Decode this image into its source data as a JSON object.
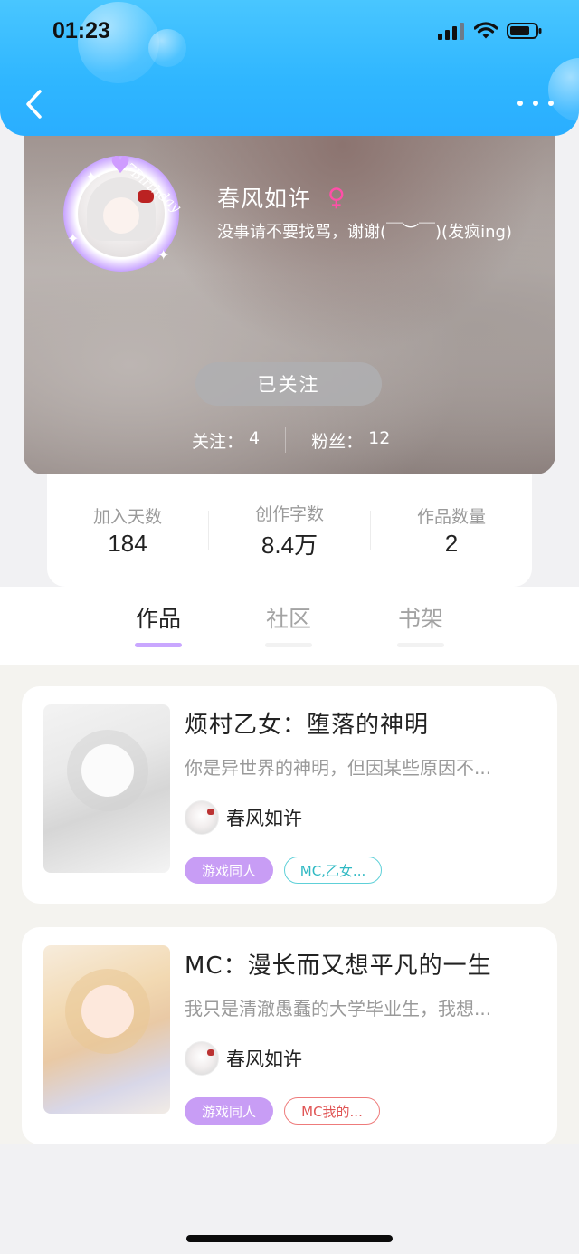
{
  "status_bar": {
    "time": "01:23"
  },
  "profile": {
    "avatar_badge": "7Birthday",
    "nickname": "春风如许",
    "gender_symbol": "♀",
    "bio": "没事请不要找骂，谢谢(￣︶￣)(发疯ing)",
    "follow_button": "已关注",
    "following_label": "关注：",
    "following_count": "4",
    "fans_label": "粉丝：",
    "fans_count": "12"
  },
  "stats": [
    {
      "label": "加入天数",
      "value": "184"
    },
    {
      "label": "创作字数",
      "value": "8.4万"
    },
    {
      "label": "作品数量",
      "value": "2"
    }
  ],
  "tabs": [
    {
      "label": "作品",
      "active": true
    },
    {
      "label": "社区",
      "active": false
    },
    {
      "label": "书架",
      "active": false
    }
  ],
  "works": [
    {
      "title": "烦村乙女：堕落的神明",
      "description": "你是异世界的神明，但因某些原因不...",
      "author": "春风如许",
      "tags": [
        "游戏同人",
        "MC,乙女..."
      ]
    },
    {
      "title": "MC：漫长而又想平凡的一生",
      "description": "我只是清澈愚蠢的大学毕业生，我想...",
      "author": "春风如许",
      "tags": [
        "游戏同人",
        "MC我的..."
      ]
    }
  ],
  "colors": {
    "header_blue": "#2fb6ff",
    "accent_purple": "#c89df5",
    "gender_pink": "#ff4fa8",
    "tag_cyan": "#2fb9c3",
    "tag_red": "#e05555"
  },
  "icons": [
    "back-arrow-icon",
    "more-dots-icon",
    "signal-icon",
    "wifi-icon",
    "battery-icon",
    "heart-icon",
    "female-icon"
  ]
}
